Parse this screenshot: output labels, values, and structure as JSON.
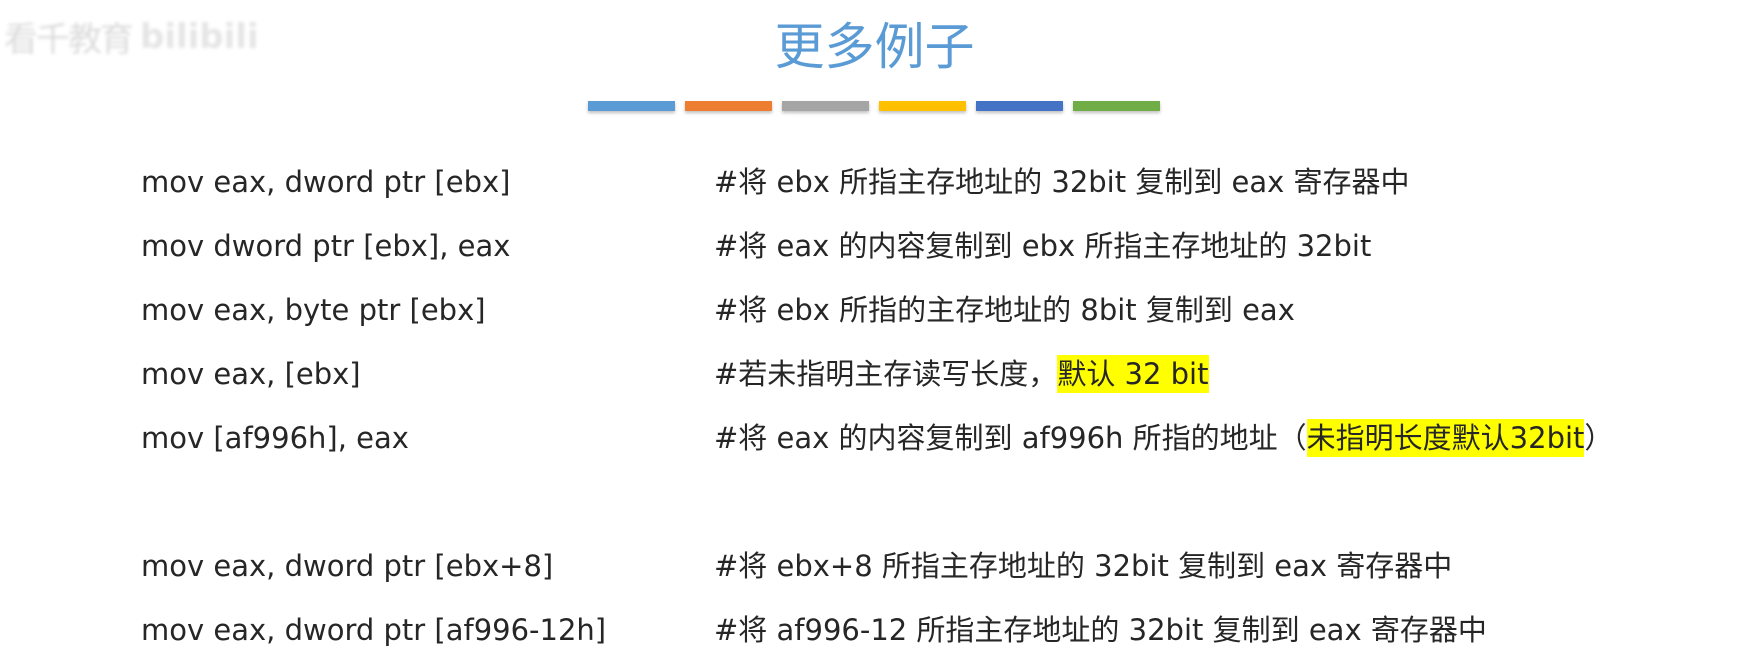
{
  "watermark": {
    "text": "看千教育",
    "brand": "bilibili"
  },
  "slide": {
    "title": "更多例子",
    "title_color": "#5b9bd5",
    "color_bars": [
      "#5b9bd5",
      "#ed7d31",
      "#a5a5a5",
      "#ffc000",
      "#4472c4",
      "#70ad47"
    ],
    "highlight_color": "#ffff00"
  },
  "rows": [
    {
      "instr": "mov eax, dword ptr [ebx]",
      "comment": "#将 ebx 所指主存地址的 32bit 复制到 eax 寄存器中"
    },
    {
      "instr": "mov dword ptr [ebx], eax",
      "comment": "#将 eax 的内容复制到 ebx 所指主存地址的 32bit"
    },
    {
      "instr": "mov eax, byte ptr [ebx]",
      "comment": "#将 ebx 所指的主存地址的 8bit 复制到 eax"
    },
    {
      "instr": "mov eax, [ebx]",
      "comment": "#若未指明主存读写长度，",
      "comment_highlight": "默认 32 bit"
    },
    {
      "instr": "mov [af996h], eax",
      "comment": "#将 eax 的内容复制到 af996h 所指的地址（",
      "comment_highlight": "未指明长度默认32bit",
      "comment_after": "）"
    },
    {
      "instr": "mov eax, dword ptr [ebx+8]",
      "comment": "#将 ebx+8 所指主存地址的 32bit 复制到 eax 寄存器中"
    },
    {
      "instr": "mov eax, dword ptr [af996-12h]",
      "comment": "#将 af996-12 所指主存地址的 32bit 复制到 eax 寄存器中"
    }
  ]
}
